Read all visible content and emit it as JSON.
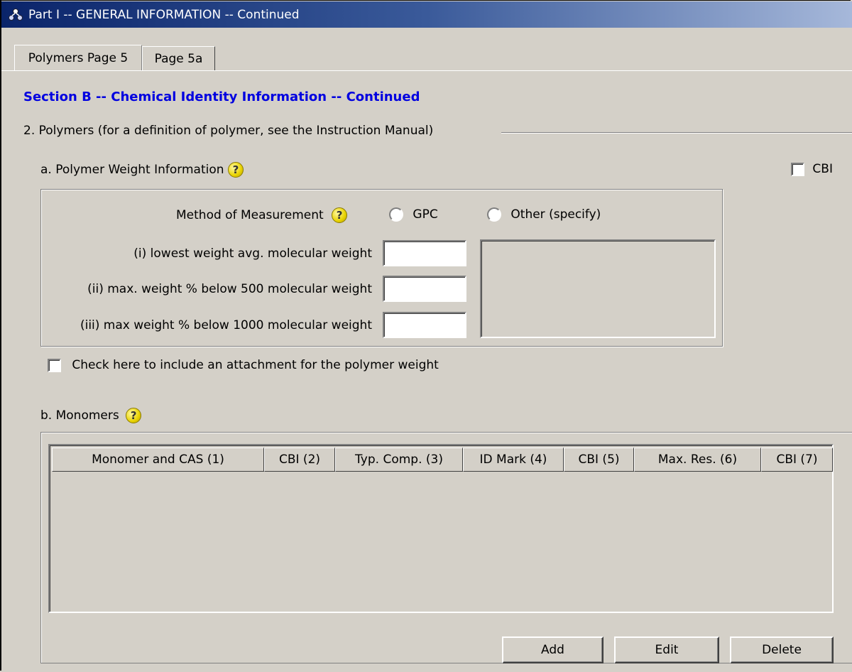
{
  "window": {
    "title": "Part I -- GENERAL INFORMATION -- Continued",
    "icon": "molecule-icon"
  },
  "tabs": [
    {
      "label": "Polymers Page 5",
      "active": true
    },
    {
      "label": "Page 5a",
      "active": false
    }
  ],
  "section_title": "Section B -- Chemical Identity Information -- Continued",
  "polymers_heading": "2. Polymers (for a definition of polymer, see the Instruction Manual)",
  "weight_info": {
    "heading": "a. Polymer Weight Information",
    "cbi_label": "CBI",
    "cbi_checked": false,
    "method_label": "Method of Measurement",
    "method_options": [
      {
        "label": "GPC",
        "selected": false
      },
      {
        "label": "Other (specify)",
        "selected": false
      }
    ],
    "fields": [
      {
        "label": "(i) lowest weight avg. molecular weight",
        "value": ""
      },
      {
        "label": "(ii) max. weight % below 500 molecular weight",
        "value": ""
      },
      {
        "label": "(iii) max weight % below 1000 molecular weight",
        "value": ""
      }
    ],
    "other_specify_value": "",
    "attachment_label": "Check here to include an attachment for the polymer weight",
    "attachment_checked": false
  },
  "monomers": {
    "heading": "b. Monomers",
    "columns": [
      "Monomer and CAS (1)",
      "CBI (2)",
      "Typ. Comp. (3)",
      "ID Mark (4)",
      "CBI (5)",
      "Max. Res. (6)",
      "CBI (7)"
    ],
    "rows": [],
    "buttons": {
      "add": "Add",
      "edit": "Edit",
      "delete": "Delete"
    }
  },
  "icons": {
    "help": "help-question-icon"
  }
}
